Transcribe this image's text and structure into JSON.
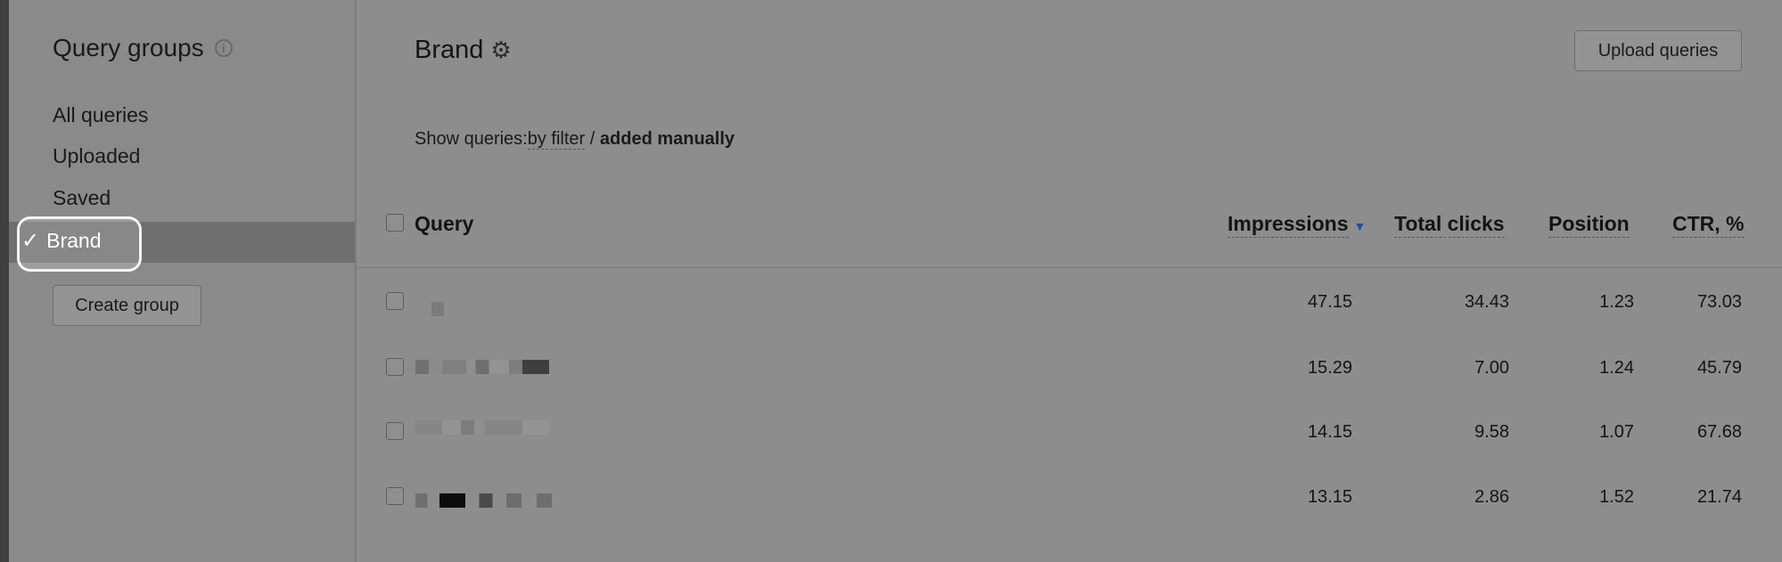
{
  "sidebar": {
    "title": "Query groups",
    "items": [
      {
        "label": "All queries"
      },
      {
        "label": "Uploaded"
      },
      {
        "label": "Saved"
      },
      {
        "label": "Brand",
        "active": true
      }
    ],
    "active_check": "✓",
    "create_button": "Create group"
  },
  "main": {
    "group_title": "Brand",
    "upload_button": "Upload queries",
    "filter": {
      "prefix": "Show queries:",
      "option_filter": "by filter",
      "separator": " / ",
      "option_manual": "added manually"
    },
    "columns": {
      "query": "Query",
      "impressions": "Impressions",
      "total_clicks": "Total clicks",
      "position": "Position",
      "ctr": "CTR, %"
    },
    "rows": [
      {
        "query": "",
        "impressions": "47.15",
        "total_clicks": "34.43",
        "position": "1.23",
        "ctr": "73.03"
      },
      {
        "query": "",
        "impressions": "15.29",
        "total_clicks": "7.00",
        "position": "1.24",
        "ctr": "45.79"
      },
      {
        "query": "",
        "impressions": "14.15",
        "total_clicks": "9.58",
        "position": "1.07",
        "ctr": "67.68"
      },
      {
        "query": "",
        "impressions": "13.15",
        "total_clicks": "2.86",
        "position": "1.52",
        "ctr": "21.74"
      }
    ]
  },
  "colors": {
    "background": "#8d8d8d",
    "sidebar_active": "#6f6f6f",
    "sort_arrow": "#1d4fa8"
  },
  "icons": [
    "info-icon",
    "checkmark-icon",
    "gear-icon",
    "sort-desc-icon",
    "checkbox"
  ]
}
